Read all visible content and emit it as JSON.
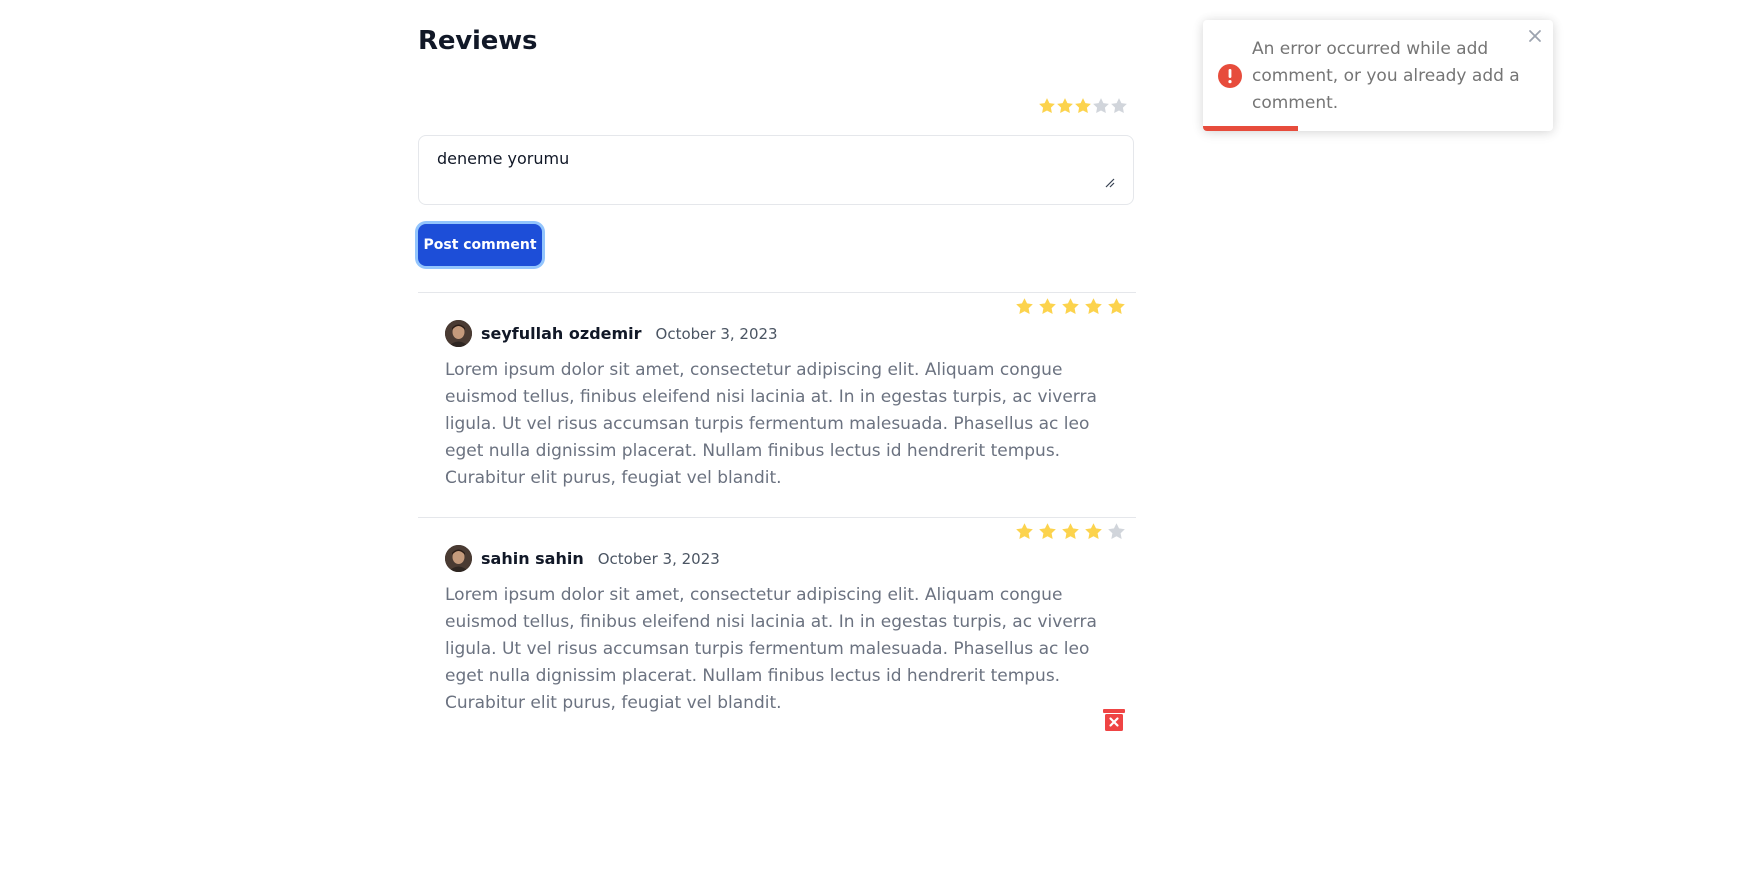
{
  "page": {
    "heading": "Reviews"
  },
  "new_comment": {
    "rating": 3,
    "max_rating": 5,
    "text": "deneme yorumu",
    "post_label": "Post comment"
  },
  "reviews": [
    {
      "author": "seyfullah ozdemir",
      "date": "October 3, 2023",
      "rating": 5,
      "body": "Lorem ipsum dolor sit amet, consectetur adipiscing elit. Aliquam congue euismod tellus, finibus eleifend nisi lacinia at. In in egestas turpis, ac viverra ligula. Ut vel risus accumsan turpis fermentum malesuada. Phasellus ac leo eget nulla dignissim placerat. Nullam finibus lectus id hendrerit tempus. Curabitur elit purus, feugiat vel blandit."
    },
    {
      "author": "sahin sahin",
      "date": "October 3, 2023",
      "rating": 4,
      "body": "Lorem ipsum dolor sit amet, consectetur adipiscing elit. Aliquam congue euismod tellus, finibus eleifend nisi lacinia at. In in egestas turpis, ac viverra ligula. Ut vel risus accumsan turpis fermentum malesuada. Phasellus ac leo eget nulla dignissim placerat. Nullam finibus lectus id hendrerit tempus. Curabitur elit purus, feugiat vel blandit.",
      "has_delete": true
    }
  ],
  "toast": {
    "message": "An error occurred while add comment, or you already add a comment.",
    "type": "error",
    "progress_remaining": 0.27
  },
  "colors": {
    "accent": "#1d4ed8",
    "star_filled": "#fcd34d",
    "star_empty": "#d1d5db",
    "error": "#e74c3c"
  },
  "icons": {
    "star": "star-icon",
    "delete": "trash-icon",
    "close": "close-icon",
    "error": "error-icon"
  }
}
